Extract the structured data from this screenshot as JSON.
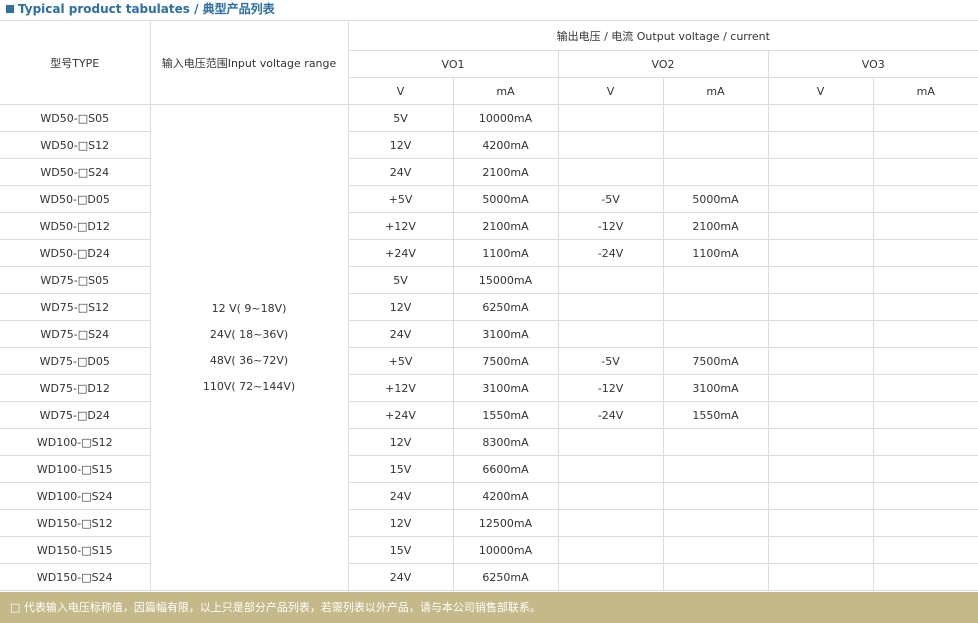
{
  "title": "Typical product tabulates / 典型产品列表",
  "colors": {
    "accent": "#2a6fa6",
    "footer_bg": "#c5b98a",
    "grid": "#dcdcdc"
  },
  "header": {
    "model": "型号TYPE",
    "input_range": "输入电压范围Input voltage range",
    "output": "输出电压  / 电流  Output voltage / current",
    "vo1": "VO1",
    "vo2": "VO2",
    "vo3": "VO3",
    "v": "V",
    "ma": "mA"
  },
  "input_ranges": [
    "12 V( 9~18V)",
    "24V( 18~36V)",
    "48V( 36~72V)",
    "110V( 72~144V)"
  ],
  "rows": [
    {
      "model": "WD50-□S05",
      "v1": "5V",
      "a1": "10000mA",
      "v2": "",
      "a2": "",
      "v3": "",
      "a3": ""
    },
    {
      "model": "WD50-□S12",
      "v1": "12V",
      "a1": "4200mA",
      "v2": "",
      "a2": "",
      "v3": "",
      "a3": ""
    },
    {
      "model": "WD50-□S24",
      "v1": "24V",
      "a1": "2100mA",
      "v2": "",
      "a2": "",
      "v3": "",
      "a3": ""
    },
    {
      "model": "WD50-□D05",
      "v1": "+5V",
      "a1": "5000mA",
      "v2": "-5V",
      "a2": "5000mA",
      "v3": "",
      "a3": ""
    },
    {
      "model": "WD50-□D12",
      "v1": "+12V",
      "a1": "2100mA",
      "v2": "-12V",
      "a2": "2100mA",
      "v3": "",
      "a3": ""
    },
    {
      "model": "WD50-□D24",
      "v1": "+24V",
      "a1": "1100mA",
      "v2": "-24V",
      "a2": "1100mA",
      "v3": "",
      "a3": ""
    },
    {
      "model": "WD75-□S05",
      "v1": "5V",
      "a1": "15000mA",
      "v2": "",
      "a2": "",
      "v3": "",
      "a3": ""
    },
    {
      "model": "WD75-□S12",
      "v1": "12V",
      "a1": "6250mA",
      "v2": "",
      "a2": "",
      "v3": "",
      "a3": ""
    },
    {
      "model": "WD75-□S24",
      "v1": "24V",
      "a1": "3100mA",
      "v2": "",
      "a2": "",
      "v3": "",
      "a3": ""
    },
    {
      "model": "WD75-□D05",
      "v1": "+5V",
      "a1": "7500mA",
      "v2": "-5V",
      "a2": "7500mA",
      "v3": "",
      "a3": ""
    },
    {
      "model": "WD75-□D12",
      "v1": "+12V",
      "a1": "3100mA",
      "v2": "-12V",
      "a2": "3100mA",
      "v3": "",
      "a3": ""
    },
    {
      "model": "WD75-□D24",
      "v1": "+24V",
      "a1": "1550mA",
      "v2": "-24V",
      "a2": "1550mA",
      "v3": "",
      "a3": ""
    },
    {
      "model": "WD100-□S12",
      "v1": "12V",
      "a1": "8300mA",
      "v2": "",
      "a2": "",
      "v3": "",
      "a3": ""
    },
    {
      "model": "WD100-□S15",
      "v1": "15V",
      "a1": "6600mA",
      "v2": "",
      "a2": "",
      "v3": "",
      "a3": ""
    },
    {
      "model": "WD100-□S24",
      "v1": "24V",
      "a1": "4200mA",
      "v2": "",
      "a2": "",
      "v3": "",
      "a3": ""
    },
    {
      "model": "WD150-□S12",
      "v1": "12V",
      "a1": "12500mA",
      "v2": "",
      "a2": "",
      "v3": "",
      "a3": ""
    },
    {
      "model": "WD150-□S15",
      "v1": "15V",
      "a1": "10000mA",
      "v2": "",
      "a2": "",
      "v3": "",
      "a3": ""
    },
    {
      "model": "WD150-□S24",
      "v1": "24V",
      "a1": "6250mA",
      "v2": "",
      "a2": "",
      "v3": "",
      "a3": ""
    }
  ],
  "footer_note": "□ 代表输入电压标称值，因篇幅有限，以上只是部分产品列表，若需列表以外产品，请与本公司销售部联系。"
}
